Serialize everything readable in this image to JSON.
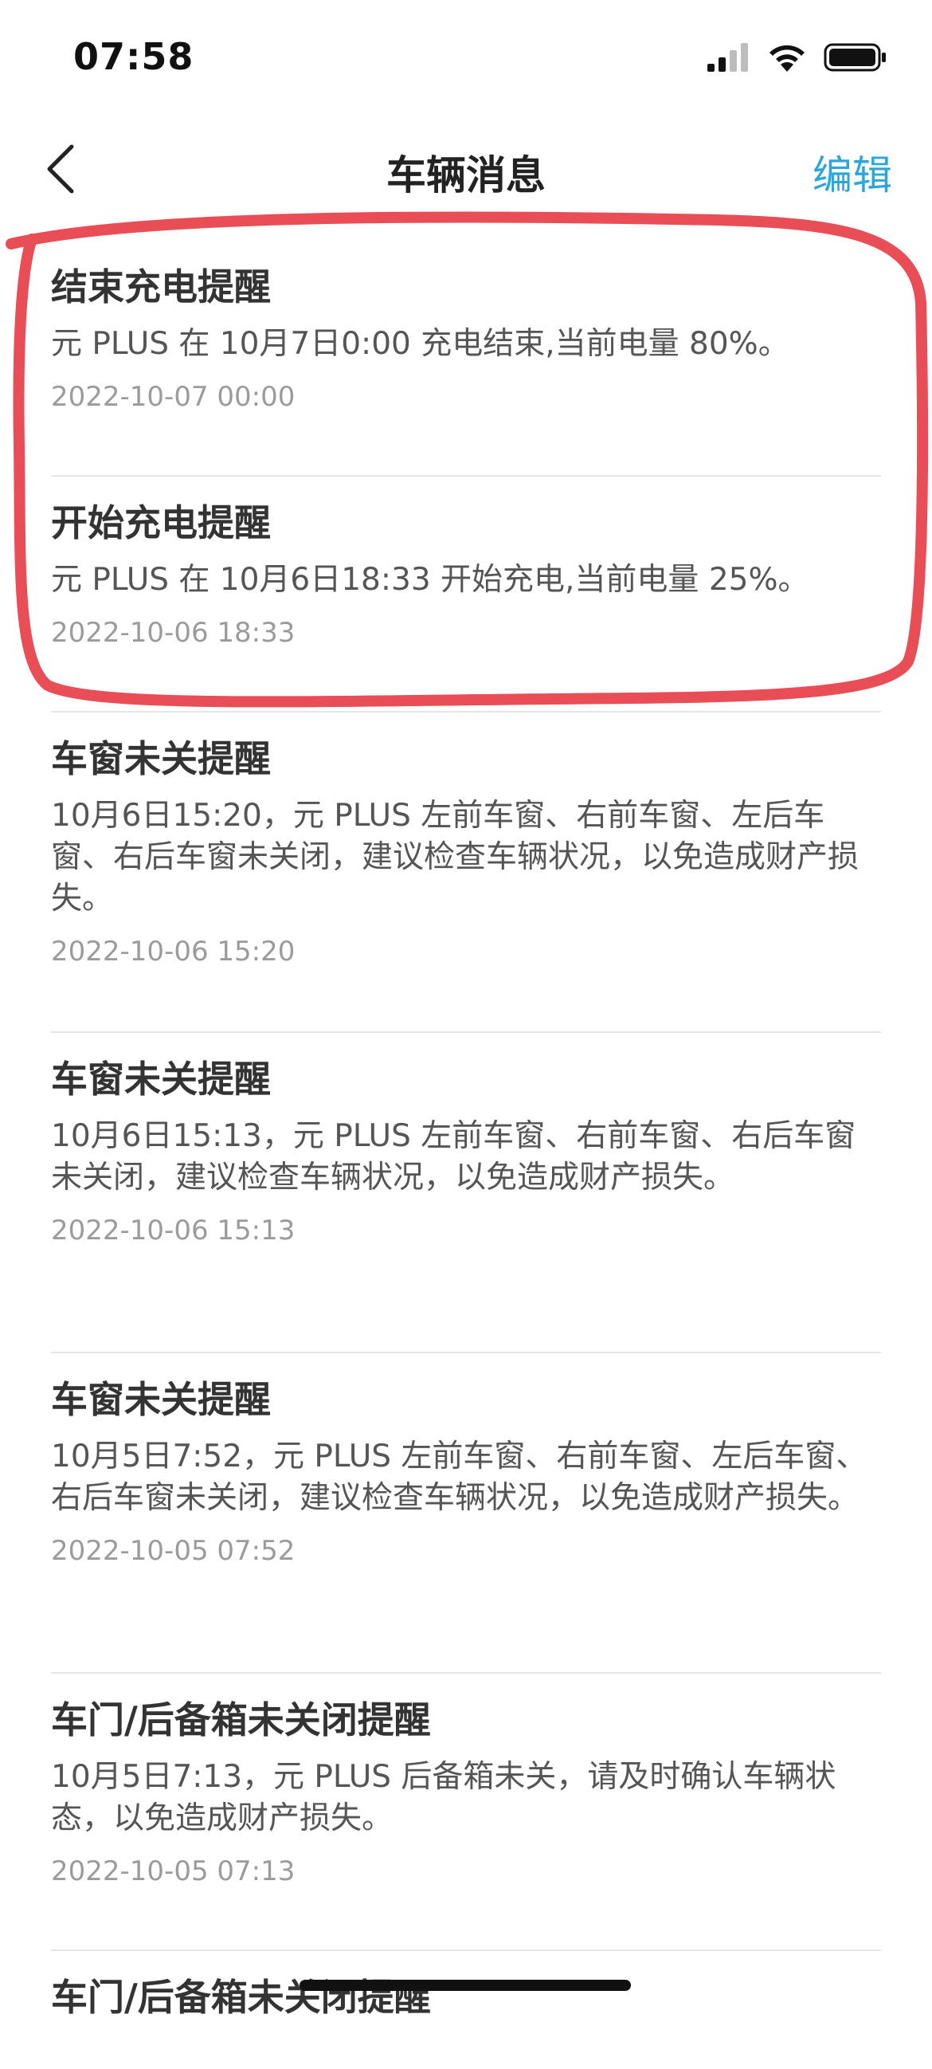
{
  "status": {
    "time": "07:58"
  },
  "nav": {
    "title": "车辆消息",
    "edit_label": "编辑"
  },
  "colors": {
    "accent": "#2aa6dd",
    "highlight": "#e94d55"
  },
  "icons": {
    "back": "chevron-left-icon",
    "signal": "cellular-signal-icon",
    "wifi": "wifi-icon",
    "battery": "battery-icon"
  },
  "messages": [
    {
      "title": "结束充电提醒",
      "body": "元 PLUS 在 10月7日0:00 充电结束,当前电量 80%。",
      "time": "2022-10-07 00:00"
    },
    {
      "title": "开始充电提醒",
      "body": "元 PLUS 在 10月6日18:33 开始充电,当前电量 25%。",
      "time": "2022-10-06 18:33"
    },
    {
      "title": "车窗未关提醒",
      "body": "10月6日15:20，元 PLUS 左前车窗、右前车窗、左后车窗、右后车窗未关闭，建议检查车辆状况，以免造成财产损失。",
      "time": "2022-10-06 15:20"
    },
    {
      "title": "车窗未关提醒",
      "body": "10月6日15:13，元 PLUS 左前车窗、右前车窗、右后车窗未关闭，建议检查车辆状况，以免造成财产损失。",
      "time": "2022-10-06 15:13"
    },
    {
      "title": "车窗未关提醒",
      "body": "10月5日7:52，元 PLUS 左前车窗、右前车窗、左后车窗、右后车窗未关闭，建议检查车辆状况，以免造成财产损失。",
      "time": "2022-10-05 07:52"
    },
    {
      "title": "车门/后备箱未关闭提醒",
      "body": "10月5日7:13，元 PLUS 后备箱未关，请及时确认车辆状态，以免造成财产损失。",
      "time": "2022-10-05 07:13"
    },
    {
      "title": "车门/后备箱未关闭提醒",
      "body": "",
      "time": ""
    }
  ]
}
